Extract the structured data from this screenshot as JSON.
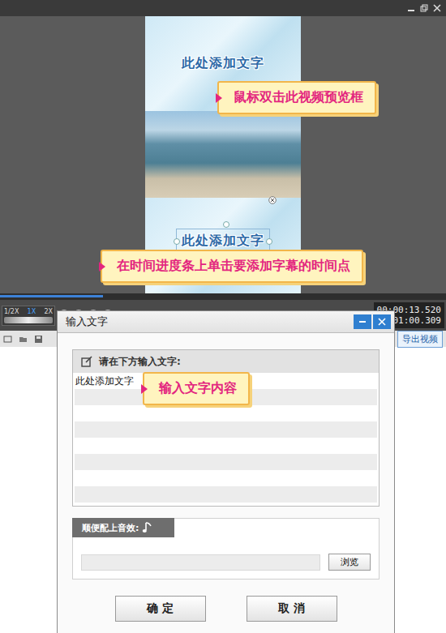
{
  "preview": {
    "top_text": "此处添加文字",
    "bottom_text": "此处添加文字"
  },
  "callouts": [
    {
      "text": "鼠标双击此视频预览框"
    },
    {
      "text": "在时间进度条上单击要添加字幕的时间点"
    },
    {
      "text": "输入文字内容"
    }
  ],
  "progress": {
    "level": 0.23
  },
  "speeds": [
    {
      "label": "1/2X",
      "selected": false
    },
    {
      "label": "1X",
      "selected": true
    },
    {
      "label": "2X",
      "selected": false
    }
  ],
  "times": {
    "current": "00:00:13.520",
    "total": "01:00.309"
  },
  "export_button": "导出视频",
  "dialog": {
    "title": "输入文字",
    "prompt": "请在下方输入文字:",
    "text": "此处添加文字",
    "sound_label": "顺便配上音效:",
    "sound_path": "",
    "browse": "浏览",
    "buttons": [
      "确 定",
      "取 消"
    ]
  }
}
